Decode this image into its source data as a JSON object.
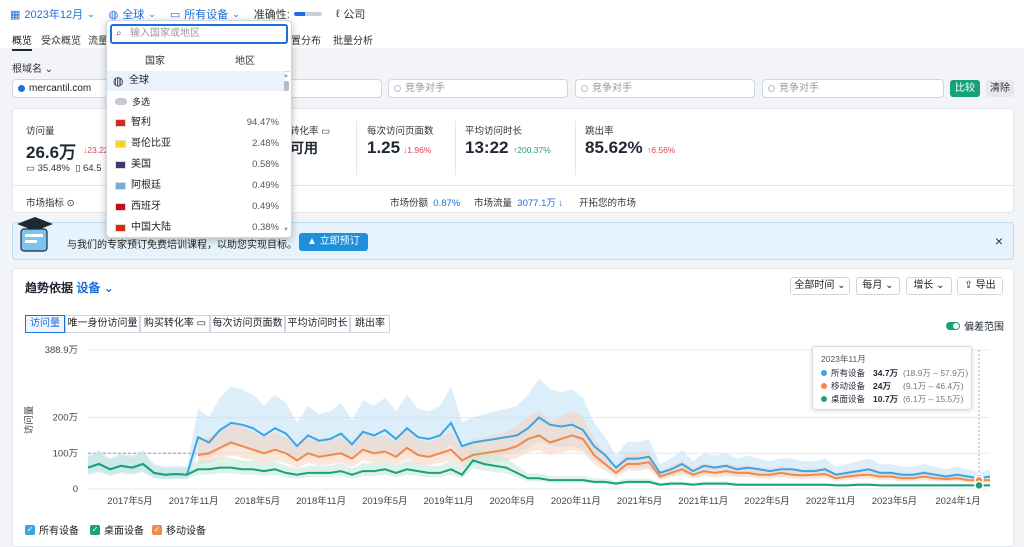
{
  "topbar": {
    "date": "2023年12月",
    "region": "全球",
    "device": "所有设备",
    "accuracy_label": "准确性:",
    "company": "公司"
  },
  "tabs": [
    "概览",
    "受众概览",
    "流量",
    "置分布",
    "批量分析"
  ],
  "root": {
    "label": "根域名",
    "domain": "mercantil.com",
    "competitor_placeholder": "竞争对手",
    "compare": "比较",
    "clear": "清除"
  },
  "metrics": {
    "visits_label": "访问量",
    "visits_value": "26.6万",
    "visits_delta": "↓23.22",
    "desktop_share": "35.48%",
    "mobile_share": "64.5",
    "conv_label": "转化率",
    "conv_value": "可用",
    "pages_label": "每次访问页面数",
    "pages_value": "1.25",
    "pages_delta": "↓1.96%",
    "duration_label": "平均访问时长",
    "duration_value": "13:22",
    "duration_delta": "↑200.37%",
    "bounce_label": "跳出率",
    "bounce_value": "85.62%",
    "bounce_delta": "↑6.56%",
    "market_label": "市场指标",
    "share_label": "市场份额",
    "share_value": "0.87%",
    "traffic_label": "市场流量",
    "traffic_value": "3077.1万",
    "expand_link": "开拓您的市场"
  },
  "banner": {
    "text": "与我们的专家预订免费培训课程，以助您实现目标。",
    "button": "立即预订"
  },
  "trend": {
    "title": "趋势依据",
    "by": "设备",
    "range": "全部时间",
    "interval": "每月",
    "growth": "增长",
    "export": "导出",
    "toggle_label": "偏差范围",
    "segments": [
      "访问量",
      "唯一身份访问量",
      "购买转化率",
      "每次访问页面数",
      "平均访问时长",
      "跳出率"
    ],
    "tooltip": {
      "date": "2023年11月",
      "rows": [
        {
          "name": "所有设备",
          "value": "34.7万",
          "range": "(18.9万 – 57.9万)",
          "color": "#3ba4e6"
        },
        {
          "name": "移动设备",
          "value": "24万",
          "range": "(9.1万 – 46.4万)",
          "color": "#f0894a"
        },
        {
          "name": "桌面设备",
          "value": "10.7万",
          "range": "(6.1万 – 15.5万)",
          "color": "#1aa179"
        }
      ]
    },
    "legend": [
      {
        "name": "所有设备",
        "color": "#3ba4e6"
      },
      {
        "name": "桌面设备",
        "color": "#1aa179"
      },
      {
        "name": "移动设备",
        "color": "#f0894a"
      }
    ]
  },
  "dropdown": {
    "placeholder": "输入国家或地区",
    "tab_country": "国家",
    "tab_region": "地区",
    "global": "全球",
    "multi": "多选",
    "countries": [
      {
        "name": "智利",
        "pct": "94.47%",
        "flag": "#d52b1e"
      },
      {
        "name": "哥伦比亚",
        "pct": "2.48%",
        "flag": "#fcd116"
      },
      {
        "name": "美国",
        "pct": "0.58%",
        "flag": "#3c3b6e"
      },
      {
        "name": "阿根廷",
        "pct": "0.49%",
        "flag": "#74acdf"
      },
      {
        "name": "西班牙",
        "pct": "0.49%",
        "flag": "#c60b1e"
      },
      {
        "name": "中国大陆",
        "pct": "0.38%",
        "flag": "#de2910"
      }
    ]
  },
  "chart_data": {
    "type": "line",
    "ylabel": "访问量",
    "yticks": [
      "0",
      "100万",
      "200万",
      "388.9万"
    ],
    "ylim": [
      0,
      388.9
    ],
    "x_ticks": [
      "2017年5月",
      "2017年11月",
      "2018年5月",
      "2018年11月",
      "2019年5月",
      "2019年11月",
      "2020年5月",
      "2020年11月",
      "2021年5月",
      "2021年11月",
      "2022年5月",
      "2022年11月",
      "2023年5月",
      "2024年1月"
    ],
    "series": [
      {
        "name": "所有设备",
        "color": "#3ba4e6",
        "values": [
          60,
          70,
          55,
          65,
          60,
          70,
          45,
          40,
          42,
          40,
          145,
          130,
          165,
          185,
          180,
          170,
          150,
          170,
          155,
          120,
          150,
          135,
          140,
          155,
          125,
          160,
          150,
          165,
          140,
          170,
          145,
          140,
          150,
          185,
          120,
          130,
          135,
          140,
          145,
          150,
          170,
          200,
          180,
          175,
          180,
          165,
          120,
          95,
          60,
          85,
          85,
          90,
          45,
          55,
          70,
          50,
          65,
          60,
          65,
          55,
          60,
          55,
          50,
          55,
          55,
          50,
          50,
          55,
          40,
          45,
          50,
          55,
          45,
          45,
          40,
          40,
          45,
          40,
          35,
          40,
          35,
          30,
          35
        ]
      },
      {
        "name": "移动设备",
        "color": "#f0894a",
        "values": [
          null,
          null,
          null,
          null,
          null,
          null,
          null,
          null,
          null,
          null,
          95,
          100,
          115,
          130,
          120,
          110,
          100,
          110,
          100,
          80,
          100,
          90,
          95,
          100,
          85,
          110,
          100,
          105,
          90,
          115,
          95,
          90,
          100,
          110,
          80,
          95,
          100,
          105,
          110,
          120,
          140,
          150,
          130,
          140,
          150,
          140,
          95,
          70,
          45,
          70,
          70,
          75,
          35,
          45,
          55,
          40,
          50,
          45,
          50,
          45,
          45,
          40,
          40,
          45,
          40,
          38,
          40,
          42,
          30,
          35,
          38,
          40,
          35,
          35,
          30,
          30,
          35,
          30,
          28,
          30,
          25,
          24,
          25
        ]
      },
      {
        "name": "桌面设备",
        "color": "#1aa179",
        "values": [
          60,
          70,
          55,
          65,
          60,
          70,
          45,
          40,
          42,
          40,
          55,
          55,
          60,
          60,
          55,
          55,
          50,
          55,
          45,
          40,
          45,
          45,
          45,
          50,
          40,
          50,
          50,
          55,
          45,
          55,
          50,
          45,
          45,
          55,
          40,
          80,
          70,
          65,
          60,
          45,
          30,
          30,
          25,
          25,
          25,
          25,
          20,
          20,
          15,
          20,
          20,
          20,
          12,
          15,
          15,
          12,
          15,
          15,
          15,
          12,
          12,
          12,
          12,
          12,
          12,
          12,
          12,
          12,
          10,
          10,
          12,
          12,
          10,
          10,
          10,
          10,
          10,
          10,
          10,
          10,
          10,
          10,
          10
        ]
      }
    ]
  }
}
